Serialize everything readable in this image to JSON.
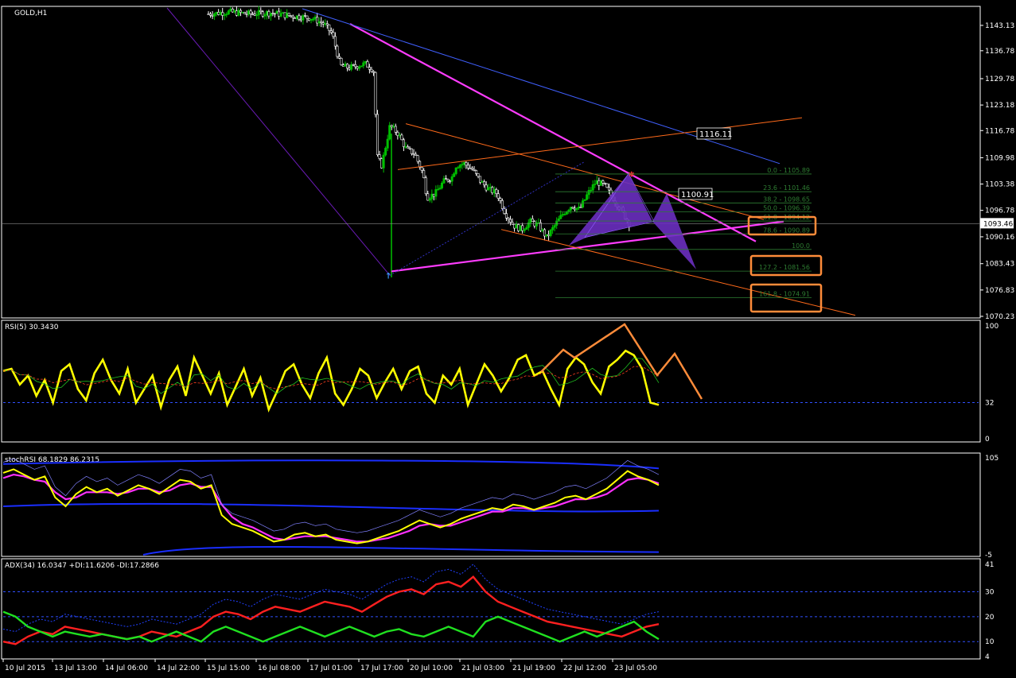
{
  "window": {
    "symbol_label": "GOLD,H1"
  },
  "colors": {
    "background": "#000000",
    "grid_border": "#ffffff",
    "bull_candle": "#00c000",
    "bear_candle": "#ffffff",
    "trend_magenta": "#ff3cff",
    "trend_blue": "#4060ff",
    "trend_orange": "#ff6a1a",
    "rsi_line": "#ffff00",
    "fib": "#2e7d32",
    "highlight_box": "#ff8c3a",
    "adx_red": "#ff2020",
    "adx_green": "#20e020",
    "adx_blue": "#2040ff"
  },
  "chart_data": [
    {
      "type": "candlestick",
      "title": "GOLD,H1",
      "y_ticks": [
        "1143.13",
        "1136.78",
        "1129.78",
        "1123.18",
        "1116.78",
        "1109.98",
        "1103.38",
        "1096.78",
        "1090.16",
        "1083.43",
        "1076.83",
        "1070.23"
      ],
      "y_range": [
        1070.23,
        1147.5
      ],
      "current_price": "1093.46",
      "price_labels": [
        "1116.11",
        "1100.91"
      ],
      "close_path": [
        [
          0,
          1146
        ],
        [
          5,
          1146.5
        ],
        [
          10,
          1146
        ],
        [
          15,
          1146.3
        ],
        [
          20,
          1145.5
        ],
        [
          25,
          1145
        ],
        [
          28,
          1143.5
        ],
        [
          30,
          1141
        ],
        [
          31,
          1137
        ],
        [
          32,
          1133
        ],
        [
          34,
          1132.5
        ],
        [
          36,
          1133
        ],
        [
          38,
          1133.5
        ],
        [
          40,
          1132
        ],
        [
          41,
          1110
        ],
        [
          42,
          1108
        ],
        [
          44,
          1118
        ],
        [
          46,
          1116
        ],
        [
          48,
          1112
        ],
        [
          50,
          1111
        ],
        [
          52,
          1106
        ],
        [
          53,
          1100
        ],
        [
          55,
          1101
        ],
        [
          57,
          1104
        ],
        [
          59,
          1105
        ],
        [
          60,
          1108
        ],
        [
          62,
          1108.5
        ],
        [
          64,
          1107
        ],
        [
          66,
          1104
        ],
        [
          68,
          1102
        ],
        [
          70,
          1101
        ],
        [
          72,
          1096
        ],
        [
          74,
          1093
        ],
        [
          76,
          1092
        ],
        [
          78,
          1094
        ],
        [
          80,
          1093
        ],
        [
          82,
          1090
        ],
        [
          84,
          1093
        ],
        [
          86,
          1096
        ],
        [
          88,
          1098
        ],
        [
          90,
          1097
        ],
        [
          92,
          1101
        ],
        [
          94,
          1104
        ],
        [
          96,
          1103
        ],
        [
          98,
          1100
        ],
        [
          100,
          1097
        ],
        [
          102,
          1093.5
        ]
      ],
      "fib_levels": [
        {
          "label": "0.0 - 1105.89",
          "value": 1105.89
        },
        {
          "label": "23.6 - 1101.46",
          "value": 1101.46
        },
        {
          "label": "38.2 - 1098.65",
          "value": 1098.65
        },
        {
          "label": "50.0 - 1096.39",
          "value": 1096.39
        },
        {
          "label": "61.8 - 1094.12",
          "value": 1094.12
        },
        {
          "label": "78.6 - 1090.89",
          "value": 1090.89
        },
        {
          "label": "100.0",
          "value": 1087.0
        },
        {
          "label": "127.2 - 1081.56",
          "value": 1081.56
        },
        {
          "label": "161.8 - 1074.91",
          "value": 1074.91
        }
      ]
    },
    {
      "type": "line",
      "title": "RSI(5) 30.3430",
      "y_ticks": [
        "100",
        "32",
        "0"
      ],
      "y_range": [
        0,
        100
      ],
      "level": 32,
      "values": [
        60,
        62,
        48,
        56,
        38,
        52,
        32,
        60,
        66,
        44,
        34,
        58,
        70,
        52,
        40,
        62,
        32,
        44,
        56,
        28,
        52,
        64,
        38,
        72,
        56,
        40,
        58,
        30,
        46,
        62,
        38,
        54,
        26,
        42,
        60,
        66,
        48,
        36,
        58,
        72,
        40,
        30,
        44,
        62,
        56,
        36,
        50,
        62,
        44,
        60,
        64,
        40,
        32,
        56,
        48,
        62,
        30,
        48,
        66,
        56,
        42,
        54,
        70,
        74,
        56,
        60,
        44,
        30,
        62,
        72,
        66,
        50,
        40,
        64,
        70,
        78,
        74,
        62,
        32,
        30
      ]
    },
    {
      "type": "line",
      "title": "stochRSI 68.1829 86.2315",
      "y_ticks": [
        "105",
        "-5"
      ],
      "y_range": [
        -5,
        105
      ],
      "values": [
        88,
        92,
        86,
        80,
        84,
        60,
        50,
        64,
        72,
        66,
        70,
        62,
        68,
        74,
        70,
        64,
        72,
        80,
        78,
        70,
        74,
        40,
        30,
        26,
        22,
        16,
        10,
        12,
        18,
        20,
        16,
        18,
        12,
        10,
        8,
        10,
        14,
        18,
        22,
        28,
        34,
        30,
        26,
        30,
        36,
        40,
        44,
        48,
        46,
        52,
        50,
        46,
        50,
        54,
        60,
        62,
        58,
        64,
        70,
        80,
        90,
        84,
        80,
        74
      ],
      "signal": [
        82,
        86,
        84,
        80,
        78,
        66,
        58,
        60,
        66,
        66,
        66,
        64,
        66,
        70,
        70,
        66,
        68,
        74,
        76,
        72,
        72,
        52,
        38,
        30,
        26,
        20,
        14,
        12,
        14,
        16,
        16,
        16,
        14,
        12,
        10,
        10,
        12,
        14,
        18,
        22,
        28,
        30,
        28,
        28,
        32,
        36,
        40,
        44,
        44,
        48,
        48,
        46,
        48,
        50,
        54,
        58,
        58,
        60,
        64,
        72,
        80,
        82,
        80,
        76
      ]
    },
    {
      "type": "line",
      "title": "ADX(34) 16.0347 +DI:11.6206 -DI:17.2866",
      "y_ticks": [
        "41",
        "30",
        "20",
        "10",
        "4"
      ],
      "y_range": [
        4,
        41
      ],
      "levels": [
        30,
        20,
        10
      ],
      "series": [
        {
          "name": "-DI",
          "values": [
            10,
            9,
            12,
            14,
            13,
            16,
            15,
            14,
            13,
            12,
            11,
            12,
            14,
            13,
            12,
            14,
            16,
            20,
            22,
            21,
            19,
            22,
            24,
            23,
            22,
            24,
            26,
            25,
            24,
            22,
            25,
            28,
            30,
            31,
            29,
            33,
            34,
            32,
            36,
            30,
            26,
            24,
            22,
            20,
            18,
            17,
            16,
            15,
            14,
            13,
            12,
            14,
            16,
            17
          ]
        },
        {
          "name": "+DI",
          "values": [
            22,
            20,
            16,
            14,
            12,
            14,
            13,
            12,
            13,
            12,
            11,
            12,
            10,
            12,
            14,
            12,
            10,
            14,
            16,
            14,
            12,
            10,
            12,
            14,
            16,
            14,
            12,
            14,
            16,
            14,
            12,
            14,
            15,
            13,
            12,
            14,
            16,
            14,
            12,
            18,
            20,
            18,
            16,
            14,
            12,
            10,
            12,
            14,
            12,
            14,
            16,
            18,
            14,
            11
          ]
        }
      ]
    }
  ],
  "x_axis": {
    "labels": [
      "10 Jul 2015",
      "13 Jul 13:00",
      "14 Jul 06:00",
      "14 Jul 22:00",
      "15 Jul 15:00",
      "16 Jul 08:00",
      "17 Jul 01:00",
      "17 Jul 17:00",
      "20 Jul 10:00",
      "21 Jul 03:00",
      "21 Jul 19:00",
      "22 Jul 12:00",
      "23 Jul 05:00"
    ]
  }
}
